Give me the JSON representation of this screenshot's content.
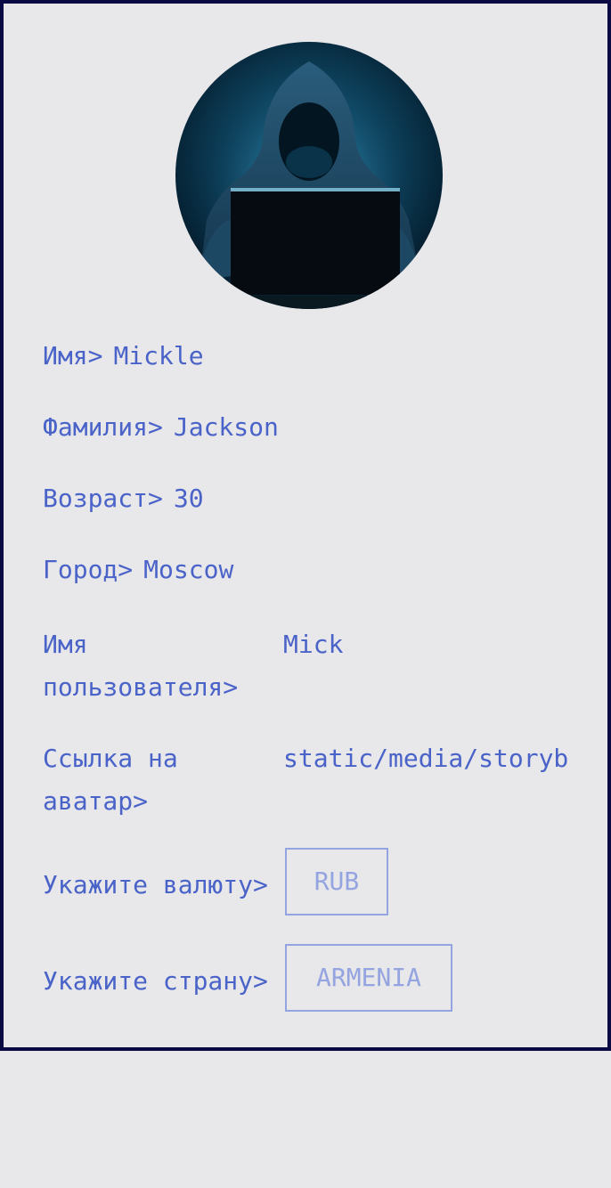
{
  "profile": {
    "first_name_label": "Имя>",
    "first_name": "Mickle",
    "last_name_label": "Фамилия>",
    "last_name": "Jackson",
    "age_label": "Возраст>",
    "age": "30",
    "city_label": "Город>",
    "city": "Moscow",
    "username_label": "Имя пользователя>",
    "username": "Mick",
    "avatar_link_label": "Ссылка на аватар>",
    "avatar_link": "static/media/storyb",
    "currency_label": "Укажите валюту>",
    "currency": "RUB",
    "country_label": "Укажите страну>",
    "country": "ARMENIA"
  },
  "avatar_icon": "hooded-hacker-avatar",
  "colors": {
    "text": "#4a63c8",
    "select_border": "#94a4e0",
    "frame": "#0b0a45",
    "background": "#e8e7ea"
  }
}
